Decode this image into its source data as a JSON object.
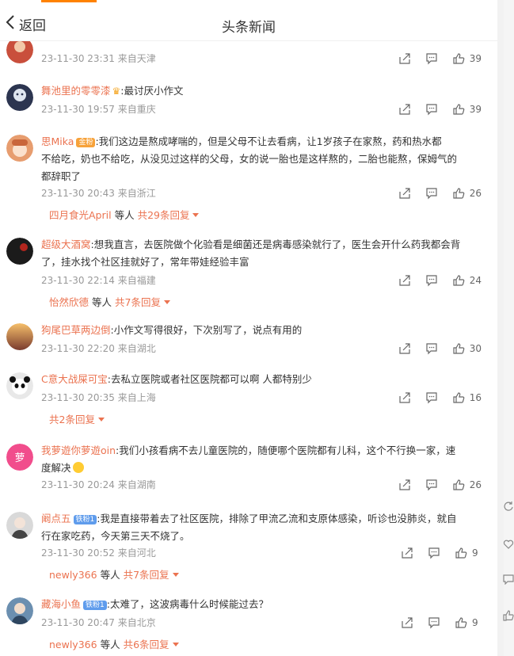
{
  "header": {
    "back_label": "返回",
    "title": "头条新闻"
  },
  "comments": [
    {
      "user": "…",
      "text": "",
      "time": "23-11-30 23:31",
      "location": "来自天津",
      "likes": "39",
      "avatar_color": "#c94f3c"
    },
    {
      "user": "舞池里的零零漆",
      "text": ":最讨厌小作文",
      "time": "23-11-30 19:57",
      "location": "来自重庆",
      "likes": "39",
      "avatar_color": "#2c3550"
    },
    {
      "user": "思Mika",
      "badge": "金粉",
      "text_lines": [
        ":我们这边是熬成哮喘的，但是父母不让去看病，让1岁孩子在家熬，药和热水都",
        "不给吃，奶也不给吃，从没见过这样的父母，女的说一胎也是这样熬的，二胎也能熬，保姆气的",
        "都辞职了"
      ],
      "time": "23-11-30 20:43",
      "location": "来自浙江",
      "likes": "26",
      "avatar_color": "#e79d6f",
      "reply_user": "四月食光April",
      "reply_mid": "等人",
      "reply_more": "共29条回复"
    },
    {
      "user": "超级大酒窝",
      "text_lines": [
        ":想我直言，去医院做个化验看是细菌还是病毒感染就行了，医生会开什么药我都会背",
        "了，挂水找个社区挂就好了，常年带娃经验丰富"
      ],
      "time": "23-11-30 22:14",
      "location": "来自福建",
      "likes": "24",
      "avatar_color": "#1b1b1b",
      "reply_user": "怡然欣德",
      "reply_mid": "等人",
      "reply_more": "共7条回复"
    },
    {
      "user": "狗尾巴草两边倒",
      "text": ":小作文写得很好，下次别写了，说点有用的",
      "time": "23-11-30 22:20",
      "location": "来自湖北",
      "likes": "30",
      "avatar_color": "#e2a35b"
    },
    {
      "user": "C意大战屎可宝",
      "text": ":去私立医院或者社区医院都可以啊 人都特别少",
      "time": "23-11-30 20:35",
      "location": "来自上海",
      "likes": "16",
      "avatar_color": "#e8e8e8",
      "reply_more": "共2条回复"
    },
    {
      "user": "我萝遊你萝遊oin",
      "text_lines": [
        ":我们小孩看病不去儿童医院的，随便哪个医院都有儿科，这个不行换一家，速",
        "度解决"
      ],
      "time": "23-11-30 20:24",
      "location": "来自湖南",
      "likes": "26",
      "avatar_color": "#f14d8c",
      "avatar_text": "萝"
    },
    {
      "user": "阚点五",
      "badge": "铁粉1",
      "text_lines": [
        ":我是直接带着去了社区医院，排除了甲流乙流和支原体感染，听诊也没肺炎，就自",
        "行在家吃药，今天第三天不烧了。"
      ],
      "time": "23-11-30 20:52",
      "location": "来自河北",
      "likes": "9",
      "avatar_color": "#d9d9d9",
      "reply_user": "newly366",
      "reply_mid": "等人",
      "reply_more": "共7条回复"
    },
    {
      "user": "藏海小鱼",
      "badge": "铁粉1",
      "text": ":太难了，这波病毒什么时候能过去？",
      "time": "23-11-30 20:47",
      "location": "来自北京",
      "likes": "9",
      "avatar_color": "#6b8fb0",
      "reply_user": "newly366",
      "reply_mid": "等人",
      "reply_more": "共6条回复"
    }
  ],
  "colors": {
    "accent": "#ff8200",
    "username": "#eb7350",
    "meta": "#999999"
  }
}
